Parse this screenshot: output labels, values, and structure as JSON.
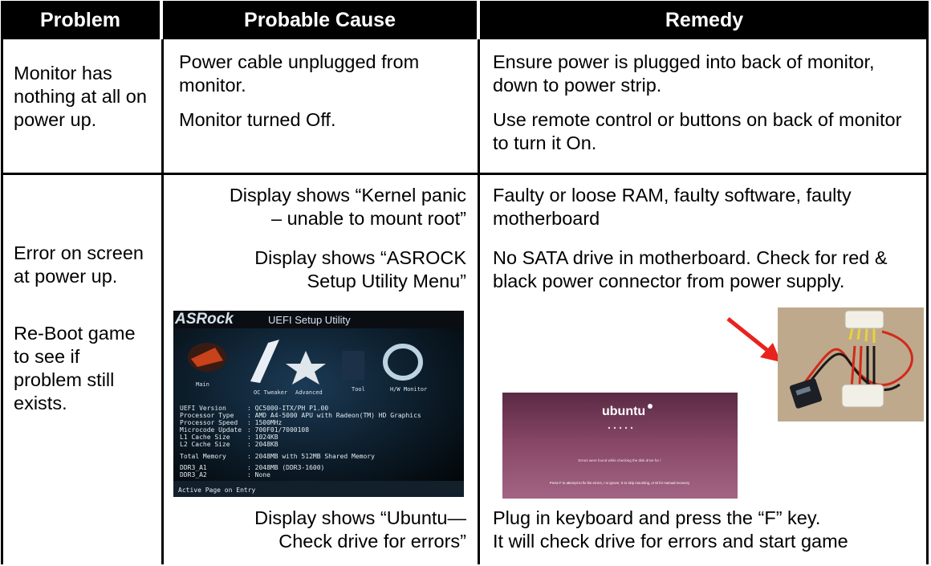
{
  "headers": {
    "problem": "Problem",
    "cause": "Probable Cause",
    "remedy": "Remedy"
  },
  "row1": {
    "problem": "Monitor has nothing at all on power up.",
    "cause_1": "Power cable unplugged from monitor.",
    "cause_2": "Monitor turned Off.",
    "remedy_1": "Ensure power is plugged into back of monitor, down to power strip.",
    "remedy_2": "Use remote control or buttons on back of monitor to turn it On."
  },
  "row2": {
    "problem_1": "Error on screen at power up.",
    "problem_2": "Re-Boot game to see if problem still exists.",
    "cause_1a": "Display shows “Kernel panic",
    "cause_1b": "– unable to mount root”",
    "cause_2a": "Display shows “ASROCK",
    "cause_2b": "Setup Utility Menu”",
    "cause_3a": "Display shows “Ubuntu—",
    "cause_3b": "Check drive for errors”",
    "remedy_1": "Faulty or loose RAM, faulty software, faulty motherboard",
    "remedy_2": "No SATA drive in motherboard. Check for red & black power connector from power supply.",
    "remedy_3a": "Plug in keyboard and press the “F” key.",
    "remedy_3b": "It will check drive for errors and start game"
  },
  "bios_screen": {
    "logo": "ASRock",
    "title": "UEFI Setup Utility",
    "tabs": [
      "Main",
      "OC Tweaker",
      "Advanced",
      "Tool",
      "H/W Monitor"
    ],
    "rows": [
      [
        "UEFI Version",
        ": QC5000-ITX/PH P1.00"
      ],
      [
        "Processor Type",
        ": AMD A4-5000 APU with Radeon(TM) HD Graphics"
      ],
      [
        "Processor Speed",
        ": 1500MHz"
      ],
      [
        "Microcode Update",
        ": 700F01/7000108"
      ],
      [
        "L1 Cache Size",
        ": 1024KB"
      ],
      [
        "L2 Cache Size",
        ": 2048KB"
      ],
      [
        "Total Memory",
        ": 2048MB with 512MB Shared Memory"
      ],
      [
        "DDR3_A1",
        ": 2048MB (DDR3-1600)"
      ],
      [
        "DDR3_A2",
        ": None"
      ]
    ],
    "footer": "Active Page on Entry"
  },
  "ubuntu_screen": {
    "logo": "ubuntu",
    "message": "Errors were found while checking the disk drive for /",
    "prompt": "Press F to attempt to fix the errors, I to ignore, S to skip mounting, or M for manual recovery"
  },
  "colors": {
    "header_bg": "#000000",
    "arrow": "#e8231d",
    "ubuntu_bg": "#7a3b5e"
  }
}
